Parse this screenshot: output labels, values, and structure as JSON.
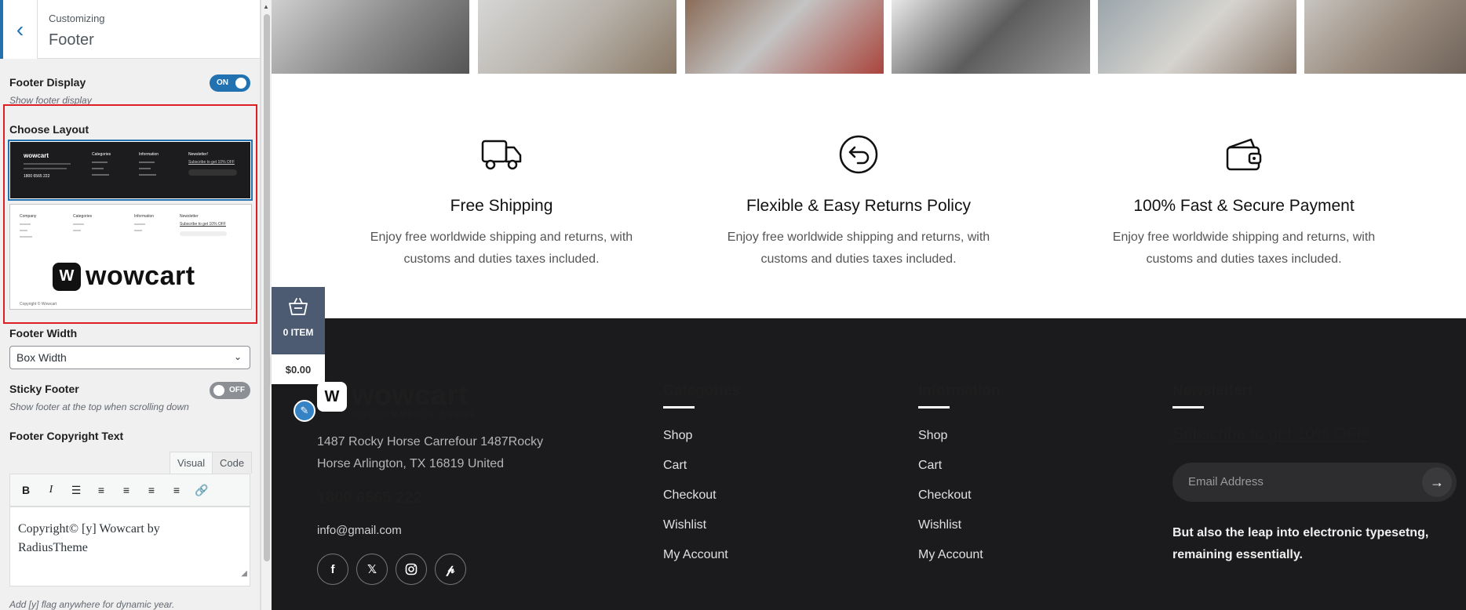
{
  "panel": {
    "breadcrumb": "Customizing",
    "title": "Footer",
    "footer_display": {
      "label": "Footer Display",
      "state": "ON",
      "description": "Show footer display"
    },
    "choose_layout": {
      "label": "Choose Layout"
    },
    "layout1_preview": {
      "logo": "wowcart",
      "cols": [
        "Categories",
        "Information",
        "Newsletter!"
      ],
      "subscribe": "Subscribe to get 10% OFF",
      "phone": "1800 6565 222"
    },
    "layout2_preview": {
      "cols": [
        "Company",
        "Categories",
        "Information",
        "Newsletter"
      ],
      "subscribe": "Subscribe to get 10% OFF",
      "logo": "wowcart",
      "copyright": "Copyright © Wowcart"
    },
    "footer_width": {
      "label": "Footer Width",
      "value": "Box Width"
    },
    "sticky_footer": {
      "label": "Sticky Footer",
      "state": "OFF",
      "description": "Show footer at the top when scrolling down"
    },
    "copyright": {
      "label": "Footer Copyright Text",
      "tab_visual": "Visual",
      "tab_code": "Code",
      "content_line1": "Copyright© [y] Wowcart by",
      "content_line2": "RadiusTheme",
      "hint": "Add [y] flag anywhere for dynamic year."
    },
    "toolbar_icons": [
      "bold-icon",
      "italic-icon",
      "bullet-list-icon",
      "numbered-list-icon",
      "align-left-icon",
      "align-center-icon",
      "align-right-icon",
      "link-icon"
    ]
  },
  "features": [
    {
      "icon": "truck-icon",
      "title": "Free Shipping",
      "desc_line1": "Enjoy free worldwide shipping and returns, with",
      "desc_line2": "customs and duties taxes included."
    },
    {
      "icon": "return-arrow-icon",
      "title": "Flexible & Easy Returns Policy",
      "desc_line1": "Enjoy free worldwide shipping and returns, with",
      "desc_line2": "customs and duties taxes included."
    },
    {
      "icon": "wallet-icon",
      "title": "100% Fast & Secure Payment",
      "desc_line1": "Enjoy free worldwide shipping and returns, with",
      "desc_line2": "customs and duties taxes included."
    }
  ],
  "cart": {
    "count": "0 ITEM",
    "total": "$0.00"
  },
  "footer": {
    "logo_word": "wowcart",
    "logo_sub": "WOOCOMMERCE THEME",
    "address_line1": "1487 Rocky Horse Carrefour 1487Rocky",
    "address_line2": "Horse Arlington, TX 16819 United",
    "phone": "1800 6565 222",
    "email": "info@gmail.com",
    "socials": [
      "facebook-icon",
      "x-icon",
      "instagram-icon",
      "pinterest-icon"
    ],
    "categories": {
      "title": "Categories",
      "links": [
        "Shop",
        "Cart",
        "Checkout",
        "Wishlist",
        "My Account"
      ]
    },
    "information": {
      "title": "Information",
      "links": [
        "Shop",
        "Cart",
        "Checkout",
        "Wishlist",
        "My Account"
      ]
    },
    "newsletter": {
      "title": "Newsletter!",
      "subscribe": "Subscribe to get 10% OFF",
      "placeholder": "Email Address",
      "text_line1": "But also the leap into electronic typesetng,",
      "text_line2": "remaining essentially."
    }
  },
  "colors": {
    "accent": "#2271b1",
    "highlight": "#dd1f25",
    "footer_bg": "#1b1b1d",
    "cart_bg": "#4c5b71"
  }
}
